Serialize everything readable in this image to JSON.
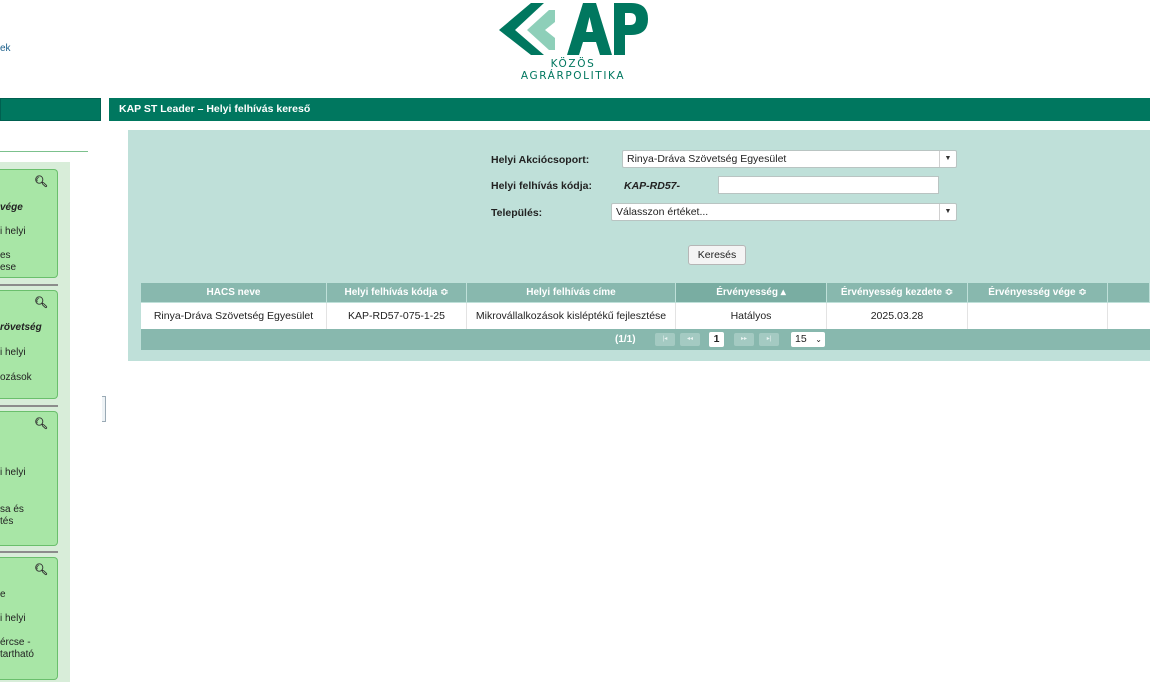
{
  "top_link": "ek",
  "logo": {
    "subtitle": "KÖZÖS AGRÁRPOLITIKA",
    "colors": {
      "primary": "#00775f",
      "light": "#8ecfb9"
    }
  },
  "sidebar": {
    "cards": [
      {
        "lines": [
          "vége",
          "i helyi",
          "es",
          "ese"
        ]
      },
      {
        "lines": [
          "rövetség",
          "i helyi",
          "ozások"
        ]
      },
      {
        "lines": [
          "i helyi",
          "sa és",
          "tés"
        ]
      },
      {
        "lines": [
          "e",
          "i helyi",
          "ércse -",
          "tartható"
        ]
      }
    ]
  },
  "main": {
    "title": "KAP ST Leader – Helyi felhívás kereső",
    "form": {
      "group_label": "Helyi Akciócsoport:",
      "group_value": "Rinya-Dráva Szövetség Egyesület",
      "code_label": "Helyi felhívás kódja:",
      "code_prefix": "KAP-RD57-",
      "code_value": "",
      "town_label": "Település:",
      "town_value": "Válasszon értéket..."
    },
    "search_button": "Keresés",
    "table": {
      "columns": [
        "HACS neve",
        "Helyi felhívás kódja ≎",
        "Helyi felhívás címe",
        "Érvényesség ▴",
        "Érvényesség kezdete ≎",
        "Érvényesség vége ≎",
        ""
      ],
      "rows": [
        [
          "Rinya-Dráva Szövetség Egyesület",
          "KAP-RD57-075-1-25",
          "Mikrovállalkozások kisléptékű fejlesztése",
          "Hatályos",
          "2025.03.28",
          "",
          ""
        ]
      ]
    },
    "pager": {
      "info": "(1/1)",
      "first": "|◂",
      "prev": "◂◂",
      "current": "1",
      "next": "▸▸",
      "last": "▸|",
      "page_size": "15"
    }
  },
  "colors": {
    "brand_green": "#00775f",
    "panel_bg": "#bfe0d9",
    "table_header": "#88b8ae",
    "card_green": "#a8e6a6"
  }
}
